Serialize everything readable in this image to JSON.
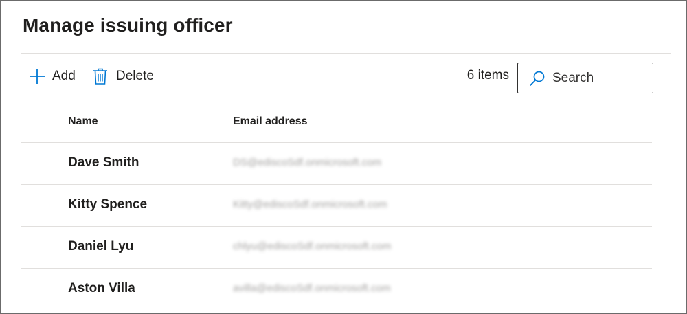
{
  "page": {
    "title": "Manage issuing officer"
  },
  "toolbar": {
    "add_label": "Add",
    "add_icon": "plus-icon",
    "delete_label": "Delete",
    "delete_icon": "trash-icon",
    "items_count": "6 items"
  },
  "search": {
    "placeholder": "Search",
    "value": "",
    "icon": "search-icon"
  },
  "table": {
    "columns": [
      "Name",
      "Email address"
    ],
    "rows": [
      {
        "name": "Dave Smith",
        "email": "DS@ediscoSdf.onmicrosoft.com"
      },
      {
        "name": "Kitty Spence",
        "email": "Kitty@ediscoSdf.onmicrosoft.com"
      },
      {
        "name": "Daniel Lyu",
        "email": "chlyu@ediscoSdf.onmicrosoft.com"
      },
      {
        "name": "Aston Villa",
        "email": "avilla@ediscoSdf.onmicrosoft.com"
      }
    ]
  },
  "colors": {
    "accent": "#0078d4",
    "text": "#201f1e",
    "divider": "#e1dfdd"
  }
}
